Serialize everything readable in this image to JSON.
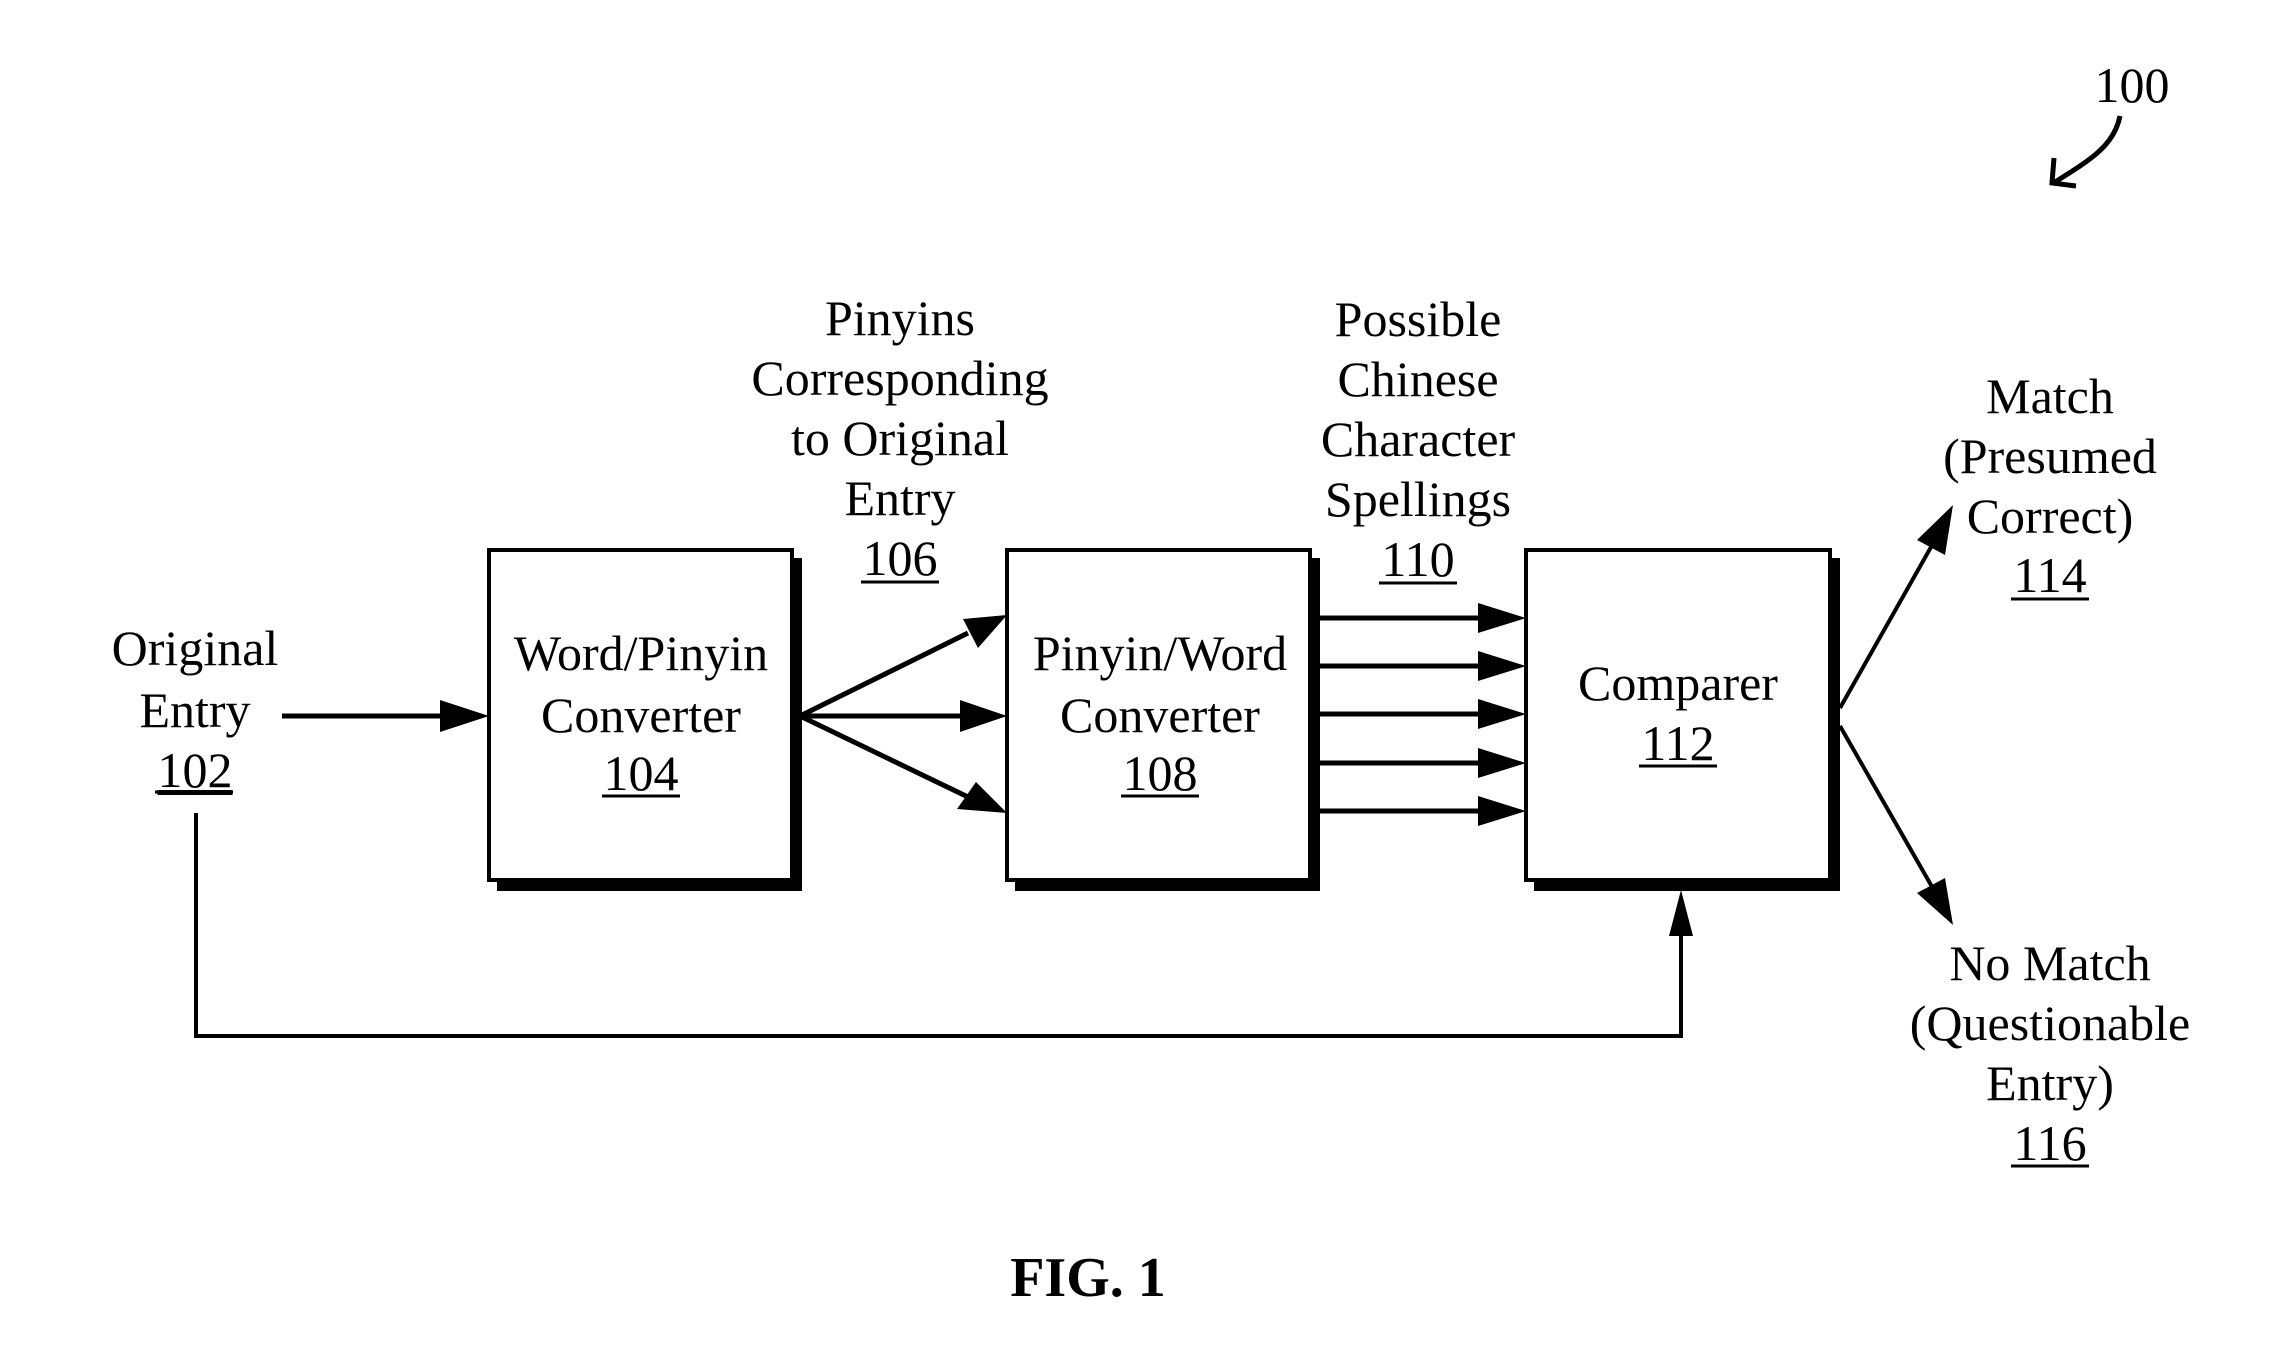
{
  "figure": {
    "ref_number": "100",
    "caption": "FIG. 1"
  },
  "nodes": {
    "original_entry": {
      "lines": [
        "Original",
        "Entry"
      ],
      "ref": "102"
    },
    "word_pinyin_converter": {
      "lines": [
        "Word/Pinyin",
        "Converter"
      ],
      "ref": "104"
    },
    "pinyins": {
      "lines": [
        "Pinyins",
        "Corresponding",
        "to Original",
        "Entry"
      ],
      "ref": "106"
    },
    "pinyin_word_converter": {
      "lines": [
        "Pinyin/Word",
        "Converter"
      ],
      "ref": "108"
    },
    "possible_spellings": {
      "lines": [
        "Possible",
        "Chinese",
        "Character",
        "Spellings"
      ],
      "ref": "110"
    },
    "comparer": {
      "lines": [
        "Comparer"
      ],
      "ref": "112"
    },
    "match": {
      "lines": [
        "Match",
        "(Presumed",
        "Correct)"
      ],
      "ref": "114"
    },
    "no_match": {
      "lines": [
        "No Match",
        "(Questionable",
        "Entry)"
      ],
      "ref": "116"
    }
  },
  "colors": {
    "ink": "#000000",
    "background": "#ffffff"
  }
}
